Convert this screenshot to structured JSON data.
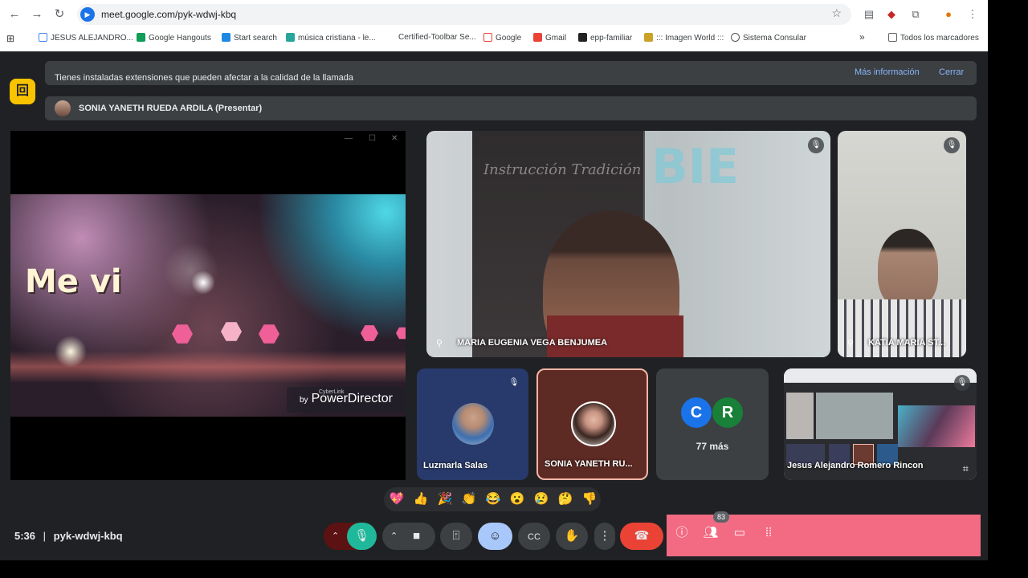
{
  "browser": {
    "url": "meet.google.com/pyk-wdwj-kbq",
    "bookmarks": [
      {
        "label": "JESUS ALEJANDRO..."
      },
      {
        "label": "Google Hangouts"
      },
      {
        "label": "Start search"
      },
      {
        "label": "música cristiana - le..."
      },
      {
        "label": "Certified-Toolbar Se..."
      },
      {
        "label": "Google"
      },
      {
        "label": "Gmail"
      },
      {
        "label": "epp-familiar"
      },
      {
        "label": "::: Imagen World :::"
      },
      {
        "label": "Sistema Consular"
      },
      {
        "label": "Todos los marcadores"
      }
    ]
  },
  "meet": {
    "extension_banner": {
      "text": "Tienes instaladas extensiones que pueden afectar a la calidad de la llamada",
      "more_info": "Más información",
      "close": "Cerrar"
    },
    "presenting_label": "SONIA YANETH RUEDA ARDILA (Presentar)",
    "shared_video": {
      "title_text": "Me vi",
      "logo_prefix": "by",
      "logo_small": "CyberLink",
      "logo_text": "PowerDirector"
    },
    "participants": [
      {
        "name": "MARIA EUGENIA VEGA BENJUMEA",
        "muted": true
      },
      {
        "name": "KATIA MARIA ST...",
        "muted": true
      },
      {
        "name": "Luzmarla Salas",
        "muted": true
      },
      {
        "name": "SONIA YANETH RU...",
        "muted": false
      },
      {
        "name": "Jesus Alejandro Romero Rincon",
        "muted": true
      }
    ],
    "book_title": "Instrucción Tradición",
    "others": {
      "initials": [
        "C",
        "R"
      ],
      "label": "77 más"
    },
    "reactions": [
      "💖",
      "👍",
      "🎉",
      "👏",
      "😂",
      "😮",
      "😢",
      "🤔",
      "👎"
    ],
    "time": "5:36",
    "meeting_code": "pyk-wdwj-kbq",
    "participant_count": "83",
    "colors": {
      "background": "#202124",
      "hangup": "#ea4335",
      "mic_active": "#1fb89a",
      "emoji_active": "#a8c7fa",
      "panel": "#f26b83"
    }
  }
}
